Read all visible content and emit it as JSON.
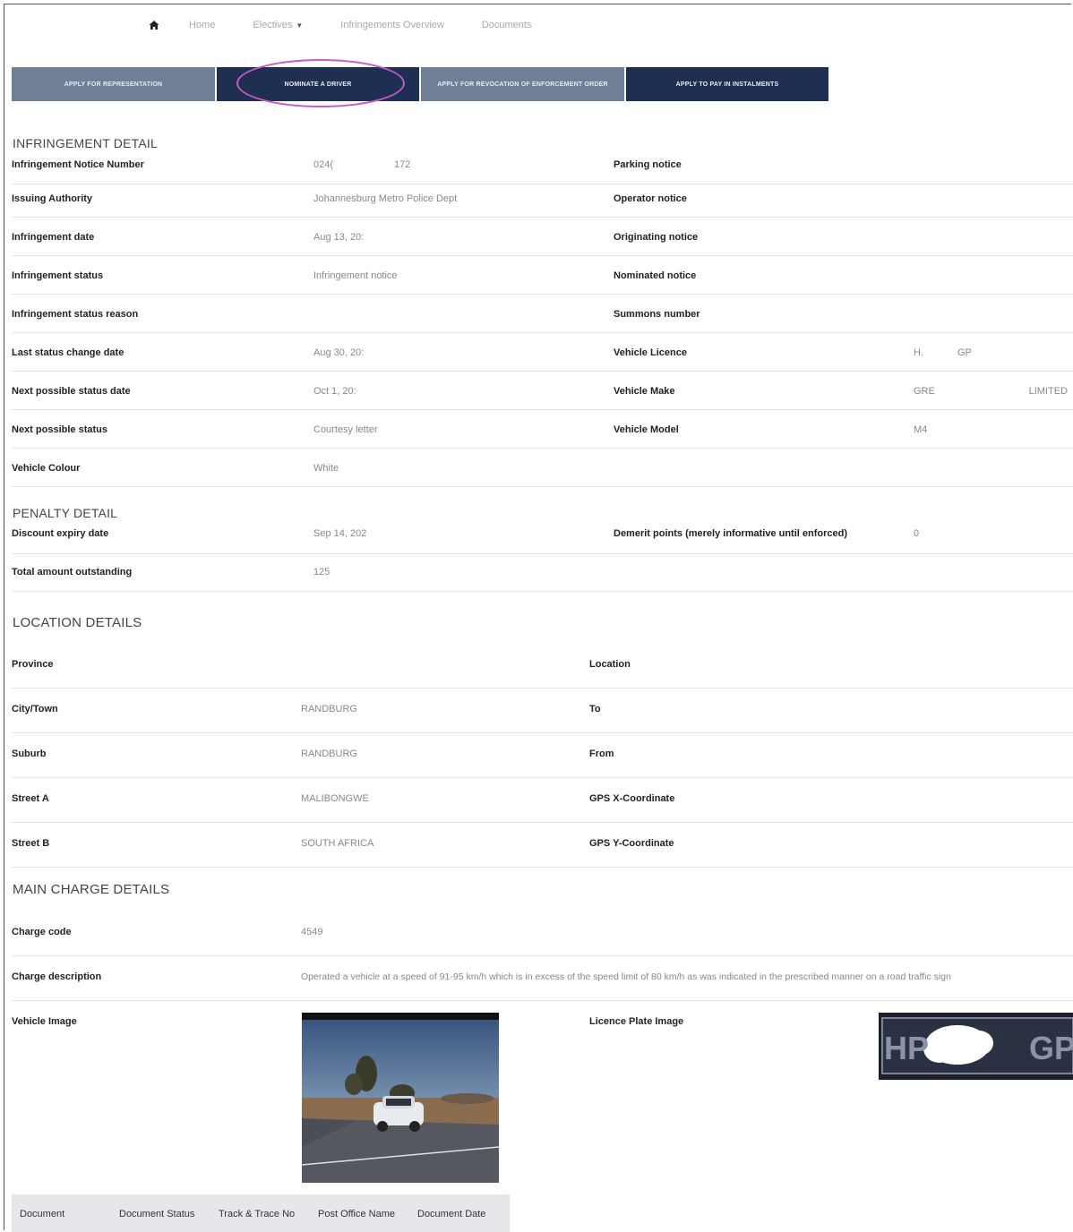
{
  "nav": {
    "items": [
      "Home",
      "Electives",
      "Infringements Overview",
      "Documents"
    ]
  },
  "actions": [
    "APPLY FOR REPRESENTATION",
    "NOMINATE A DRIVER",
    "APPLY FOR REVOCATION OF ENFORCEMENT ORDER",
    "APPLY TO PAY IN INSTALMENTS"
  ],
  "infringement": {
    "title": "INFRINGEMENT DETAIL",
    "rows": [
      {
        "l1": "Infringement Notice Number",
        "v1": "024(",
        "v1b": "172",
        "l2": "Parking notice",
        "v2": "",
        "v2b": ""
      },
      {
        "l1": "Issuing Authority",
        "v1": "Johannesburg Metro Police Dept",
        "v1b": "",
        "l2": "Operator notice",
        "v2": "",
        "v2b": ""
      },
      {
        "l1": "Infringement date",
        "v1": "Aug 13, 20:",
        "v1b": "",
        "l2": "Originating notice",
        "v2": "",
        "v2b": ""
      },
      {
        "l1": "Infringement status",
        "v1": "Infringement notice",
        "v1b": "",
        "l2": "Nominated notice",
        "v2": "",
        "v2b": ""
      },
      {
        "l1": "Infringement status reason",
        "v1": "",
        "v1b": "",
        "l2": "Summons number",
        "v2": "",
        "v2b": ""
      },
      {
        "l1": "Last status change date",
        "v1": "Aug 30, 20:",
        "v1b": "",
        "l2": "Vehicle Licence",
        "v2": "H.",
        "v2b": "GP"
      },
      {
        "l1": "Next possible status date",
        "v1": "Oct 1, 20:",
        "v1b": "",
        "l2": "Vehicle Make",
        "v2": "GRE",
        "v2b": "LIMITED"
      },
      {
        "l1": "Next possible status",
        "v1": "Courtesy letter",
        "v1b": "",
        "l2": "Vehicle Model",
        "v2": "M4",
        "v2b": ""
      },
      {
        "l1": "Vehicle Colour",
        "v1": "White",
        "v1b": "",
        "l2": "",
        "v2": "",
        "v2b": ""
      }
    ]
  },
  "penalty": {
    "title": "PENALTY DETAIL",
    "rows": [
      {
        "l1": "Discount expiry date",
        "v1": "Sep 14, 202",
        "l2": "Demerit points (merely informative until enforced)",
        "v2": "0"
      },
      {
        "l1": "Total amount outstanding",
        "v1": "125",
        "l2": "",
        "v2": ""
      }
    ]
  },
  "location": {
    "title": "LOCATION DETAILS",
    "rows": [
      {
        "l1": "Province",
        "v1": "",
        "l2": "Location"
      },
      {
        "l1": "City/Town",
        "v1": "RANDBURG",
        "l2": "To"
      },
      {
        "l1": "Suburb",
        "v1": "RANDBURG",
        "l2": "From"
      },
      {
        "l1": "Street A",
        "v1": "MALIBONGWE",
        "l2": "GPS X-Coordinate"
      },
      {
        "l1": "Street B",
        "v1": "SOUTH AFRICA",
        "l2": "GPS Y-Coordinate"
      }
    ]
  },
  "charge": {
    "title": "MAIN CHARGE DETAILS",
    "code_label": "Charge code",
    "code": "4549",
    "desc_label": "Charge description",
    "desc": "Operated a vehicle at a speed of 91-95 km/h which is in excess of the speed limit of 80 km/h as was indicated in the prescribed manner on a road traffic sign",
    "vehicle_image_label": "Vehicle Image",
    "plate_image_label": "Licence Plate Image",
    "plate_left": "HP",
    "plate_right": "GP"
  },
  "documents": {
    "headers": [
      "Document",
      "Document Status",
      "Track & Trace No",
      "Post Office Name",
      "Document Date"
    ]
  }
}
